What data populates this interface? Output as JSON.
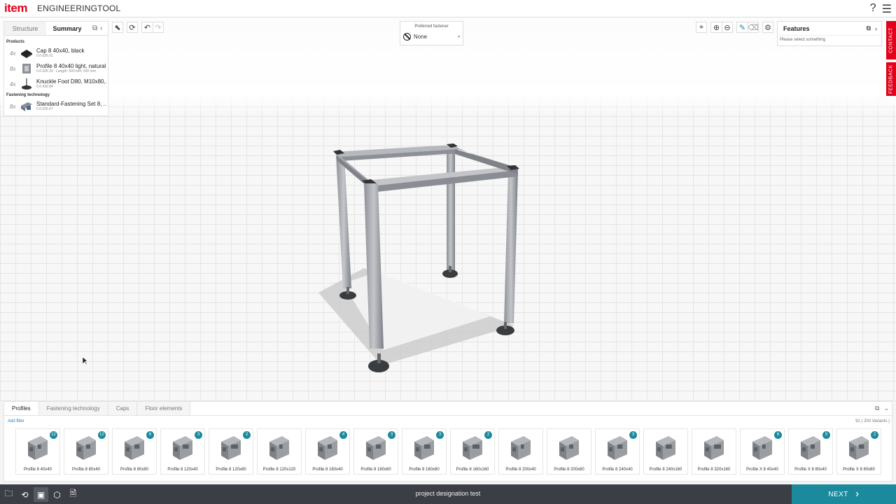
{
  "app": {
    "logo": "item",
    "title": "ENGINEERINGTOOL",
    "help_icon": "?",
    "menu_icon": "☰"
  },
  "left_panel": {
    "tabs": [
      "Structure",
      "Summary"
    ],
    "active_tab": "Summary",
    "sections": {
      "products": "Products",
      "fastening": "Fastening technology"
    },
    "products": [
      {
        "qty": "4x",
        "name": "Cap 8 40x40, black",
        "code": "0.0.026.01"
      },
      {
        "qty": "8x",
        "name": "Profile 8 40x40 light, natural",
        "code": "0.0.026.33 · Length: 500 mm; 550 mm"
      },
      {
        "qty": "4x",
        "name": "Knuckle Foot D80, M10x80,...",
        "code": "0.0.432.84"
      }
    ],
    "fastening": [
      {
        "qty": "8x",
        "name": "Standard-Fastening Set 8, ...",
        "code": "0.0.026.07"
      }
    ]
  },
  "fastener": {
    "label": "Preferred fastener",
    "value": "None"
  },
  "features": {
    "title": "Features",
    "hint": "Please select something"
  },
  "side_tabs": {
    "contact": "CONTACT",
    "feedback": "FEEDBACK"
  },
  "catalog": {
    "tabs": [
      "Profiles",
      "Fastening technology",
      "Caps",
      "Floor elements"
    ],
    "active_tab": "Profiles",
    "add_filter": "Add filter",
    "variants": "91 ( 200 Variants )",
    "items": [
      {
        "label": "Profile 8 40x40",
        "badge": "12"
      },
      {
        "label": "Profile 8 80x40",
        "badge": "12"
      },
      {
        "label": "Profile 8 80x80",
        "badge": "6"
      },
      {
        "label": "Profile 8 120x40",
        "badge": "3"
      },
      {
        "label": "Profile 8 120x80",
        "badge": "2"
      },
      {
        "label": "Profile 8 120x120",
        "badge": ""
      },
      {
        "label": "Profile 8 160x40",
        "badge": "4"
      },
      {
        "label": "Profile 8 160x60",
        "badge": "3"
      },
      {
        "label": "Profile 8 160x80",
        "badge": "3"
      },
      {
        "label": "Profile 8 160x160",
        "badge": "2"
      },
      {
        "label": "Profile 8 200x40",
        "badge": ""
      },
      {
        "label": "Profile 8 200x80",
        "badge": ""
      },
      {
        "label": "Profile 8 240x40",
        "badge": "3"
      },
      {
        "label": "Profile 8 240x160",
        "badge": ""
      },
      {
        "label": "Profile 8 320x160",
        "badge": ""
      },
      {
        "label": "Profile X 8 40x40",
        "badge": "6"
      },
      {
        "label": "Profile X 8 80x40",
        "badge": "5"
      },
      {
        "label": "Profile X 8 80x80",
        "badge": "2"
      }
    ]
  },
  "footer": {
    "project": "project designation test",
    "next": "NEXT"
  },
  "colors": {
    "brand": "#e2001a",
    "accent": "#1a8a9c",
    "footer": "#3b3f45"
  }
}
